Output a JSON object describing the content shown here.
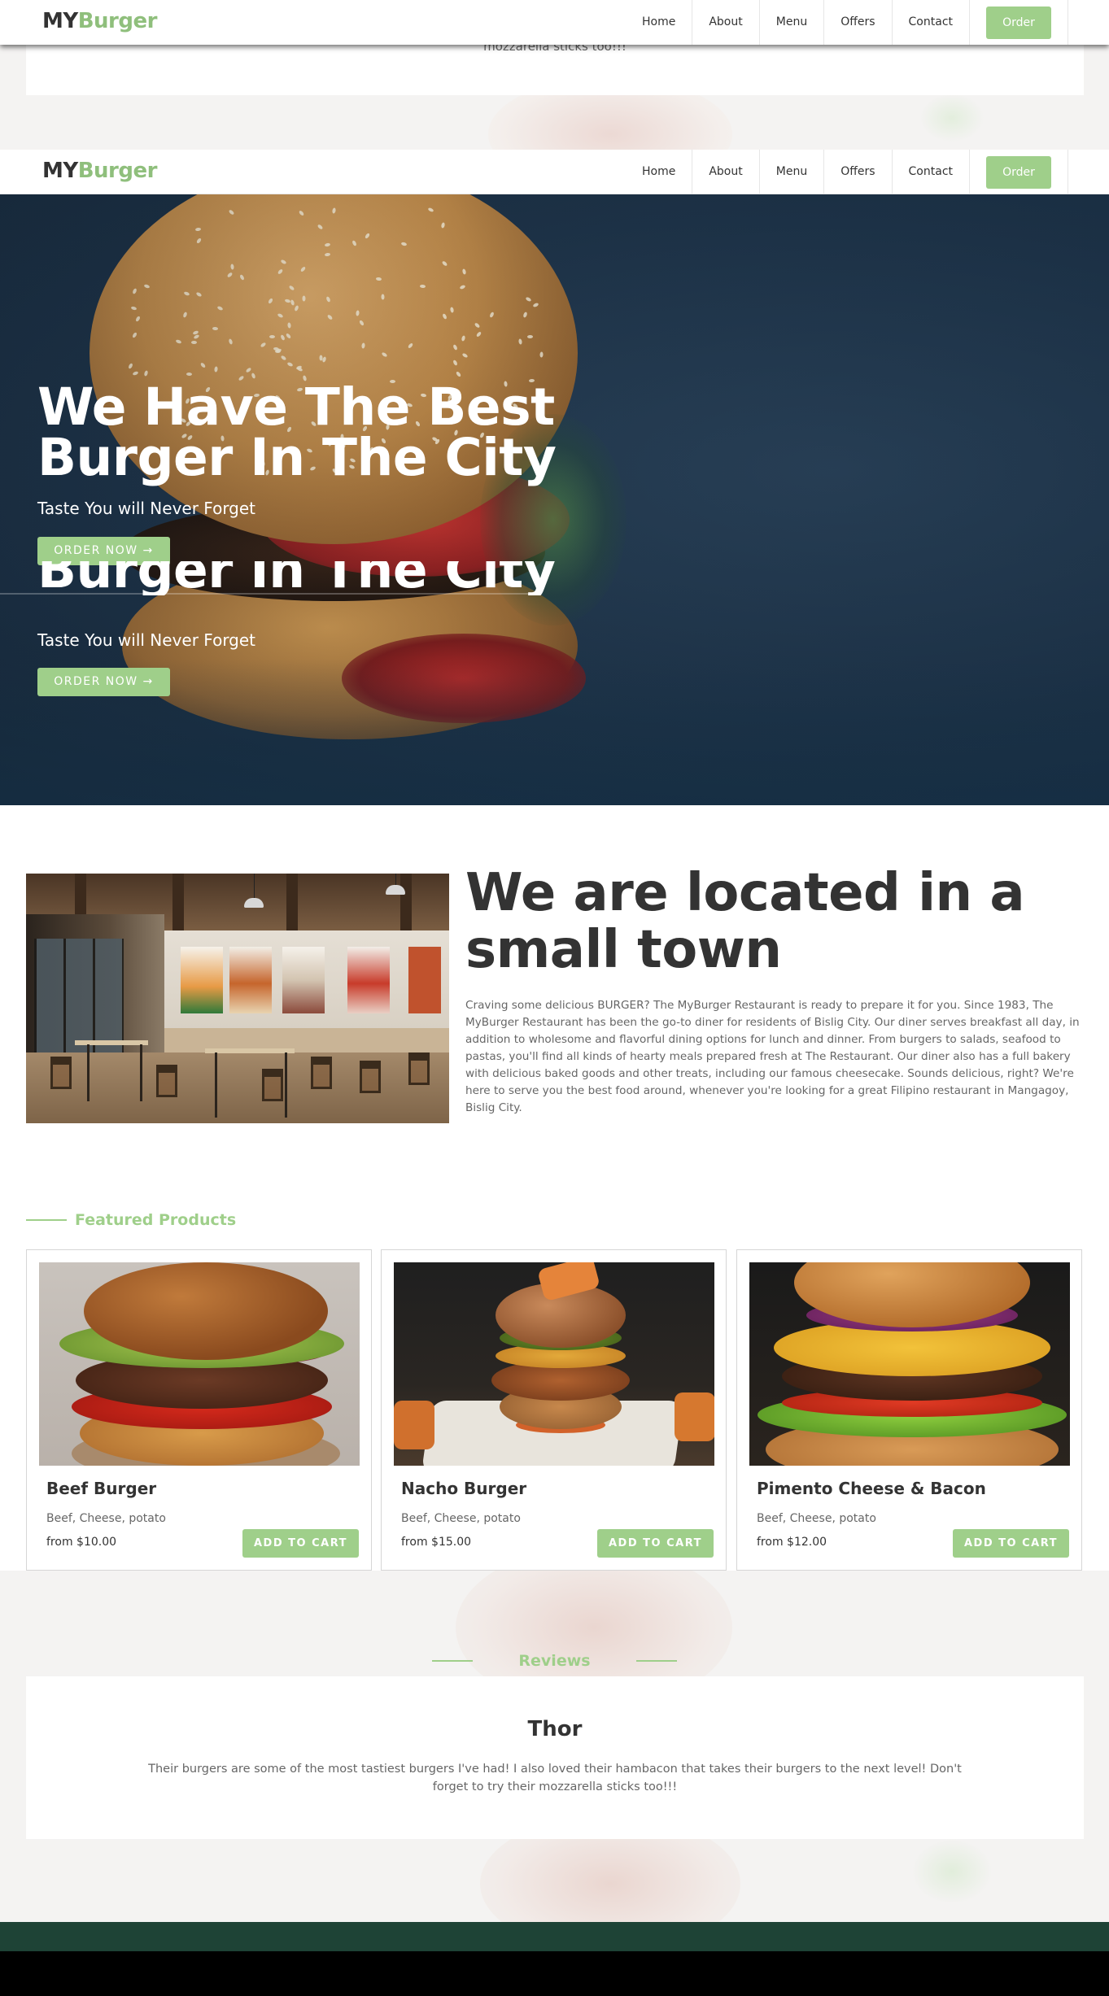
{
  "brand": {
    "my": "MY",
    "burger": "Burger"
  },
  "nav": {
    "items": [
      "Home",
      "About",
      "Menu",
      "Offers",
      "Contact"
    ],
    "order": "Order"
  },
  "top_remnant": {
    "review_tail": "mozzarella sticks too!!!"
  },
  "hero": {
    "title_line1": "We Have The Best",
    "title_line2": "Burger In The City",
    "subtitle": "Taste You will Never Forget",
    "button": "ORDER NOW →",
    "ghost_title": "Burger In The City"
  },
  "about": {
    "title": "We are located in a small town",
    "text": "Craving some delicious BURGER? The MyBurger Restaurant is ready to prepare it for you. Since 1983, The MyBurger Restaurant has been the go-to diner for residents of Bislig City. Our diner serves breakfast all day, in addition to wholesome and flavorful dining options for lunch and dinner. From burgers to salads, seafood to pastas, you'll find all kinds of hearty meals prepared fresh at The Restaurant. Our diner also has a full bakery with delicious baked goods and other treats, including our famous cheesecake. Sounds delicious, right? We're here to serve you the best food around, whenever you're looking for a great Filipino restaurant in Mangagoy, Bislig City."
  },
  "featured": {
    "heading": "Featured Products",
    "products": [
      {
        "name": "Beef Burger",
        "desc": "Beef, Cheese, potato",
        "price": "from $10.00",
        "button": "ADD TO CART"
      },
      {
        "name": "Nacho Burger",
        "desc": "Beef, Cheese, potato",
        "price": "from $15.00",
        "button": "ADD TO CART"
      },
      {
        "name": "Pimento Cheese & Bacon",
        "desc": "Beef, Cheese, potato",
        "price": "from $12.00",
        "button": "ADD TO CART"
      }
    ]
  },
  "reviews": {
    "heading": "Reviews",
    "name": "Thor",
    "text": "Their burgers are some of the most tastiest burgers I've had! I also loved their hambacon that takes their burgers to the next level! Don't forget to try their mozzarella sticks too!!!"
  },
  "colors": {
    "accent": "#9fcf8a",
    "dark": "#333333",
    "footer": "#1e4336"
  }
}
